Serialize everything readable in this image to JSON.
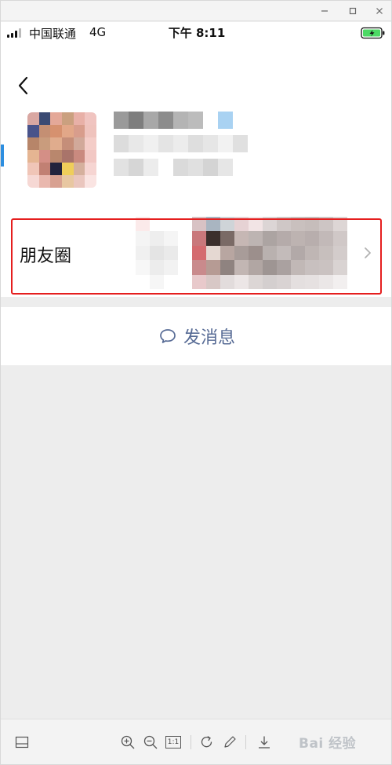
{
  "window": {
    "controls": [
      "minimize-icon",
      "maximize-icon",
      "close-icon"
    ]
  },
  "statusbar": {
    "carrier": "中国联通",
    "network": "4G",
    "time": "下午 8:11"
  },
  "profile": {
    "back_icon": "chevron-left-icon",
    "avatar": "pixelated-avatar",
    "name": "",
    "details": ""
  },
  "moments": {
    "label": "朋友圈",
    "chevron_icon": "chevron-right-icon"
  },
  "message": {
    "icon": "chat-bubble-icon",
    "label": "发消息"
  },
  "toolbar": {
    "icons": [
      "panel-icon",
      "zoom-in-icon",
      "zoom-out-icon",
      "actual-size-icon",
      "rotate-icon",
      "edit-icon",
      "download-icon"
    ],
    "actual_size_label": "1:1",
    "watermark": "Bai 经验"
  },
  "colors": {
    "link": "#576b95",
    "highlight": "#e51e1e",
    "background": "#ededed"
  }
}
